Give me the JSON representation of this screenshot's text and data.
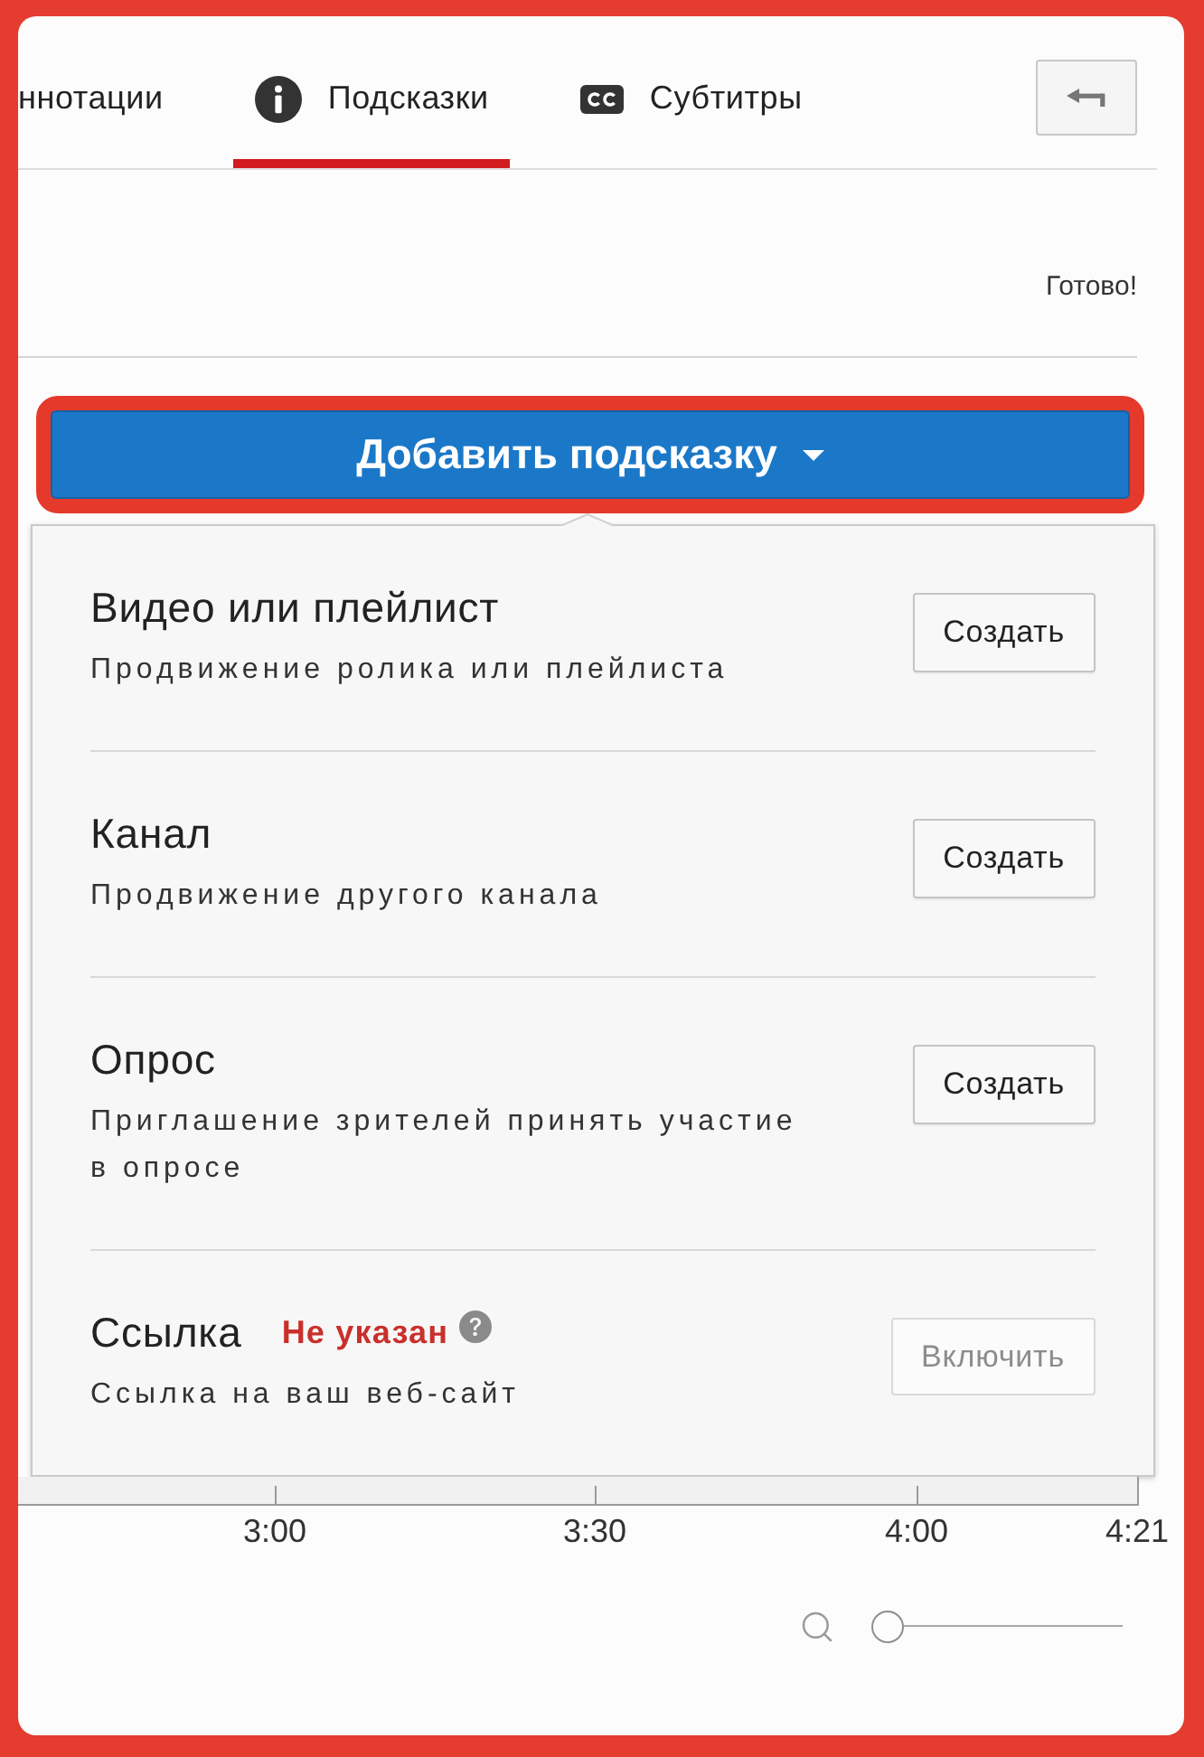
{
  "tabs": [
    {
      "kind": "plain",
      "label": "ннотации",
      "selected": false
    },
    {
      "kind": "info",
      "label": "Подсказки",
      "selected": true
    },
    {
      "kind": "captions",
      "label": "Субтитры",
      "selected": false
    }
  ],
  "save_status": "Готово!",
  "add_button": {
    "label": "Добавить подсказку",
    "highlighted": true
  },
  "menu_items": [
    {
      "title": "Видео или плейлист",
      "description": "Продвижение ролика или плейлиста",
      "button": {
        "label": "Создать",
        "disabled": false
      }
    },
    {
      "title": "Канал",
      "description": "Продвижение другого канала",
      "button": {
        "label": "Создать",
        "disabled": false
      }
    },
    {
      "title": "Опрос",
      "description": "Приглашение зрителей принять участие в опросе",
      "button": {
        "label": "Создать",
        "disabled": false
      }
    },
    {
      "title": "Ссылка",
      "note": "Не указан",
      "description": "Ссылка на ваш веб-сайт",
      "button": {
        "label": "Включить",
        "disabled": true
      }
    }
  ],
  "timeline": {
    "labels": [
      "3:00",
      "3:30",
      "4:00",
      "4:21"
    ]
  },
  "zoom": {
    "level": 0
  }
}
